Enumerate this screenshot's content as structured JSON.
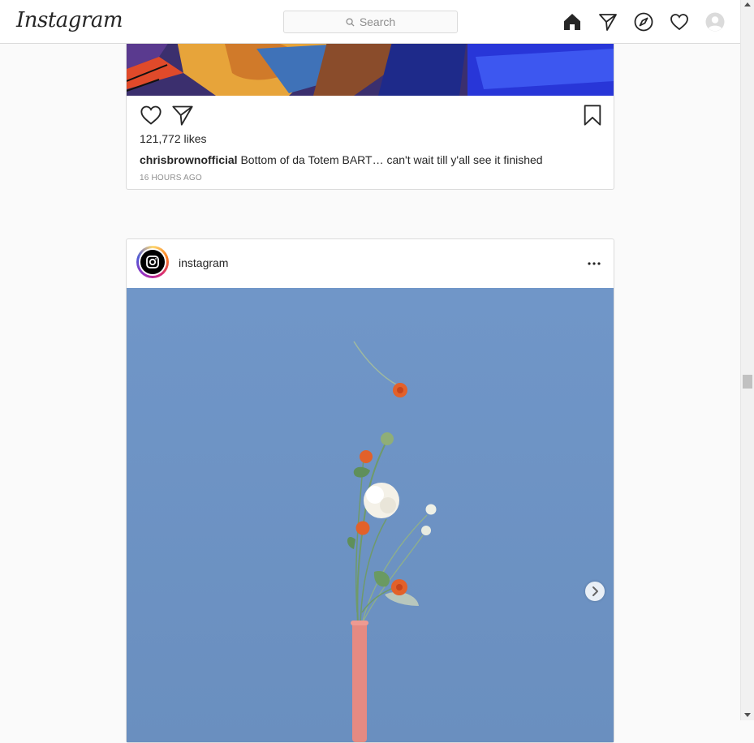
{
  "nav": {
    "logo": "Instagram",
    "search_placeholder": "Search",
    "icons": [
      "home-icon",
      "direct-icon",
      "explore-icon",
      "activity-heart-icon",
      "profile-avatar-icon"
    ]
  },
  "post1": {
    "likes": "121,772 likes",
    "caption_user": "chrisbrownofficial",
    "caption_text": "Bottom of da Totem BART… can't wait till y'all see it finished",
    "timestamp": "16 HOURS AGO"
  },
  "post2": {
    "username": "instagram",
    "image_alt": "flowers in a pink vase against a blue background"
  },
  "colors": {
    "text": "#262626",
    "muted": "#8e8e8e",
    "border": "#dbdbdb",
    "background": "#fafafa",
    "sky": "#6f95c6",
    "vase": "#e58a82",
    "flower_orange": "#e2612a"
  }
}
